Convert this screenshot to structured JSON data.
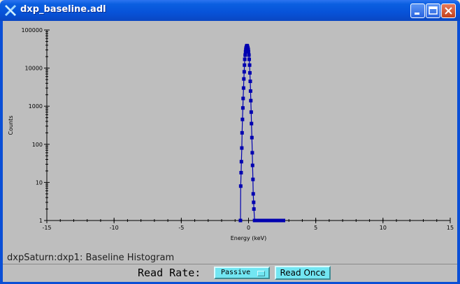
{
  "window": {
    "title": "dxp_baseline.adl"
  },
  "colors": {
    "series": "#0000b0",
    "plot_bg": "#bebebe",
    "button_bg": "#72e6f2"
  },
  "caption": "dxpSaturn:dxp1: Baseline Histogram",
  "controls": {
    "read_rate_label": "Read Rate:",
    "read_rate_value": "Passive",
    "read_once_label": "Read Once"
  },
  "chart_data": {
    "type": "scatter",
    "xlabel": "Energy (keV)",
    "ylabel": "Counts",
    "xlim": [
      -15,
      15
    ],
    "ylim": [
      1,
      100000
    ],
    "yscale": "log",
    "xticks": [
      -15,
      -10,
      -5,
      0,
      5,
      10,
      15
    ],
    "yticks": [
      1,
      10,
      100,
      1000,
      10000,
      100000
    ],
    "grid": false,
    "series": [
      {
        "x": [
          -0.6,
          -0.58,
          -0.55,
          -0.53,
          -0.5,
          -0.48,
          -0.45,
          -0.42,
          -0.4,
          -0.37,
          -0.35,
          -0.32,
          -0.3,
          -0.28,
          -0.25,
          -0.22,
          -0.2,
          -0.18,
          -0.15,
          -0.12,
          -0.1,
          -0.08,
          -0.05,
          -0.02,
          0.0,
          0.03,
          0.05,
          0.08,
          0.1,
          0.13,
          0.15,
          0.17,
          0.2,
          0.22,
          0.25,
          0.28,
          0.3,
          0.33,
          0.35,
          0.38,
          0.4,
          0.45,
          0.5,
          0.6,
          0.7,
          0.8,
          0.9,
          1.0,
          1.2,
          1.4,
          1.6,
          1.8,
          2.0,
          2.2,
          2.4,
          2.6
        ],
        "y": [
          1,
          8,
          18,
          35,
          80,
          200,
          450,
          900,
          1600,
          3000,
          5200,
          8000,
          12000,
          17000,
          22000,
          27000,
          31000,
          34000,
          37000,
          39000,
          38500,
          37000,
          34000,
          31000,
          27000,
          22000,
          17000,
          12000,
          7500,
          4500,
          2500,
          1400,
          700,
          350,
          150,
          60,
          28,
          12,
          5,
          3,
          2,
          1,
          1,
          1,
          1,
          1,
          1,
          1,
          1,
          1,
          1,
          1,
          1,
          1,
          1,
          1
        ]
      }
    ]
  }
}
